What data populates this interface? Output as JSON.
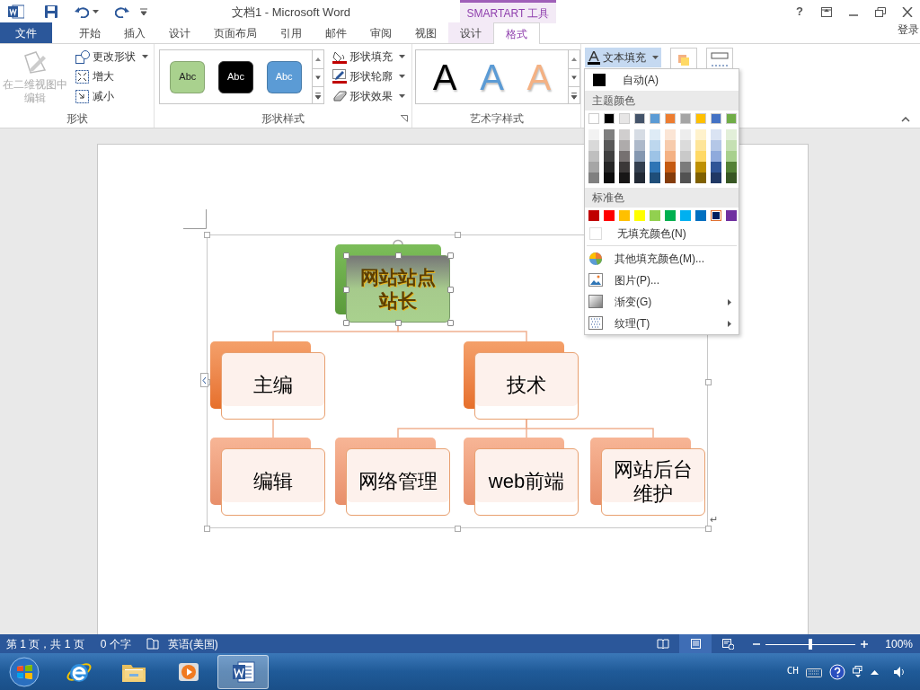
{
  "title_bar": {
    "title": "文档1 - Microsoft Word",
    "context_label": "SMARTART 工具",
    "help": "?"
  },
  "tabs": [
    {
      "label": "文件",
      "selected": false,
      "kind": "file"
    },
    {
      "label": "开始",
      "selected": false,
      "kind": "standard"
    },
    {
      "label": "插入",
      "selected": false,
      "kind": "standard"
    },
    {
      "label": "设计",
      "selected": false,
      "kind": "standard"
    },
    {
      "label": "页面布局",
      "selected": false,
      "kind": "standard"
    },
    {
      "label": "引用",
      "selected": false,
      "kind": "standard"
    },
    {
      "label": "邮件",
      "selected": false,
      "kind": "standard"
    },
    {
      "label": "审阅",
      "selected": false,
      "kind": "standard"
    },
    {
      "label": "视图",
      "selected": false,
      "kind": "standard"
    },
    {
      "label": "设计",
      "selected": false,
      "kind": "contextual"
    },
    {
      "label": "格式",
      "selected": true,
      "kind": "contextual"
    }
  ],
  "sign_in": "登录",
  "ribbon": {
    "shapes_group": {
      "label": "形状",
      "edit_2d": {
        "label": "在二维视图中编辑",
        "disabled": true
      },
      "buttons": [
        {
          "label": "更改形状",
          "dropdown": true
        },
        {
          "label": "增大",
          "dropdown": false
        },
        {
          "label": "减小",
          "dropdown": false
        }
      ]
    },
    "shape_styles_group": {
      "label": "形状样式",
      "swatches": [
        {
          "label": "Abc",
          "color": "#a9d18e"
        },
        {
          "label": "Abc",
          "color": "#000000"
        },
        {
          "label": "Abc",
          "color": "#5b9bd5"
        }
      ],
      "buttons": [
        {
          "label": "形状填充"
        },
        {
          "label": "形状轮廓"
        },
        {
          "label": "形状效果"
        }
      ]
    },
    "wordart_group": {
      "label": "艺术字样式",
      "styles": [
        {
          "label": "A",
          "color": "#000000"
        },
        {
          "label": "A",
          "color": "#5b9bd5"
        },
        {
          "label": "A",
          "color": "#f4b183"
        }
      ],
      "text_fill": {
        "label": "文本填充",
        "open": true
      }
    }
  },
  "fill_menu": {
    "auto": {
      "label": "自动(A)",
      "color": "#000000"
    },
    "theme_header": "主题颜色",
    "theme_colors": [
      {
        "color": "#ffffff",
        "shades": [
          {
            "color": "#f2f2f2"
          },
          {
            "color": "#d9d9d9"
          },
          {
            "color": "#bfbfbf"
          },
          {
            "color": "#a6a6a6"
          },
          {
            "color": "#808080"
          }
        ]
      },
      {
        "color": "#000000",
        "shades": [
          {
            "color": "#7f7f7f"
          },
          {
            "color": "#595959"
          },
          {
            "color": "#404040"
          },
          {
            "color": "#262626"
          },
          {
            "color": "#0d0d0d"
          }
        ]
      },
      {
        "color": "#e7e6e6",
        "shades": [
          {
            "color": "#d0cece"
          },
          {
            "color": "#aeabab"
          },
          {
            "color": "#767171"
          },
          {
            "color": "#3b3838"
          },
          {
            "color": "#171616"
          }
        ]
      },
      {
        "color": "#44546a",
        "shades": [
          {
            "color": "#d6dce4"
          },
          {
            "color": "#adb9ca"
          },
          {
            "color": "#8497b0"
          },
          {
            "color": "#333f4f"
          },
          {
            "color": "#222a35"
          }
        ]
      },
      {
        "color": "#5b9bd5",
        "shades": [
          {
            "color": "#deebf6"
          },
          {
            "color": "#bdd7ee"
          },
          {
            "color": "#9dc3e6"
          },
          {
            "color": "#2e75b5"
          },
          {
            "color": "#1f4e79"
          }
        ]
      },
      {
        "color": "#ed7d31",
        "shades": [
          {
            "color": "#fbe5d5"
          },
          {
            "color": "#f7cbac"
          },
          {
            "color": "#f4b183"
          },
          {
            "color": "#c55a11"
          },
          {
            "color": "#843c0b"
          }
        ]
      },
      {
        "color": "#a5a5a5",
        "shades": [
          {
            "color": "#ededed"
          },
          {
            "color": "#dbdbdb"
          },
          {
            "color": "#c9c9c9"
          },
          {
            "color": "#7b7b7b"
          },
          {
            "color": "#525252"
          }
        ]
      },
      {
        "color": "#ffc000",
        "shades": [
          {
            "color": "#fff2cc"
          },
          {
            "color": "#fee599"
          },
          {
            "color": "#ffd965"
          },
          {
            "color": "#bf9000"
          },
          {
            "color": "#7f6000"
          }
        ]
      },
      {
        "color": "#4472c4",
        "shades": [
          {
            "color": "#dae3f3"
          },
          {
            "color": "#b4c7e7"
          },
          {
            "color": "#8faadc"
          },
          {
            "color": "#2f5597"
          },
          {
            "color": "#203864"
          }
        ]
      },
      {
        "color": "#70ad47",
        "shades": [
          {
            "color": "#e2efd9"
          },
          {
            "color": "#c5e0b3"
          },
          {
            "color": "#a8d08d"
          },
          {
            "color": "#538135"
          },
          {
            "color": "#375623"
          }
        ]
      }
    ],
    "standard_header": "标准色",
    "standard_colors": [
      {
        "color": "#c00000",
        "selected": false
      },
      {
        "color": "#ff0000",
        "selected": false
      },
      {
        "color": "#ffc000",
        "selected": false
      },
      {
        "color": "#ffff00",
        "selected": false
      },
      {
        "color": "#92d050",
        "selected": false
      },
      {
        "color": "#00b050",
        "selected": false
      },
      {
        "color": "#00b0f0",
        "selected": false
      },
      {
        "color": "#0070c0",
        "selected": false
      },
      {
        "color": "#002060",
        "selected": true
      },
      {
        "color": "#7030a0",
        "selected": false
      }
    ],
    "no_fill": "无填充颜色(N)",
    "items": [
      {
        "label": "其他填充颜色(M)...",
        "submenu": false
      },
      {
        "label": "图片(P)...",
        "submenu": false
      },
      {
        "label": "渐变(G)",
        "submenu": true
      },
      {
        "label": "纹理(T)",
        "submenu": true
      }
    ]
  },
  "diagram": {
    "root": {
      "text": "网站站点站长",
      "selected": true,
      "children": [
        {
          "text": "主编",
          "children": [
            {
              "text": "编辑"
            }
          ]
        },
        {
          "text": "技术",
          "children": [
            {
              "text": "网络管理"
            },
            {
              "text": "web前端"
            },
            {
              "text": "网站后台维护"
            }
          ]
        }
      ]
    }
  },
  "paragraph_mark": "↵",
  "status_bar": {
    "page": "第 1 页，共 1 页",
    "words": "0 个字",
    "language": "英语(美国)",
    "zoom": "100%",
    "zoom_slider": {
      "level": 0.5
    },
    "views": [
      {
        "selected": false
      },
      {
        "selected": true
      },
      {
        "selected": false
      }
    ]
  },
  "taskbar": {
    "apps": [
      {
        "active": false
      },
      {
        "active": false
      },
      {
        "active": false
      },
      {
        "active": true
      }
    ],
    "input_lang": "CH"
  }
}
